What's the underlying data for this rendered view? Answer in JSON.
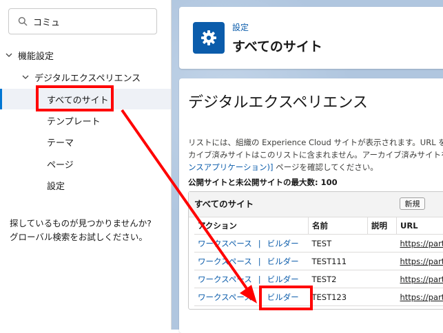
{
  "sidebar": {
    "search": {
      "value": "コミュ",
      "icon": "search-icon"
    },
    "tree": {
      "root": "機能設定",
      "child": "デジタルエクスペリエンス",
      "items": [
        "すべてのサイト",
        "テンプレート",
        "テーマ",
        "ページ",
        "設定"
      ],
      "selected": "すべてのサイト"
    },
    "no_hit_line1": "探しているものが見つかりませんか?",
    "no_hit_line2": "グローバル検索をお試しください。"
  },
  "header": {
    "crumb": "設定",
    "title": "すべてのサイト",
    "icon": "gear-icon"
  },
  "content": {
    "title": "デジタルエクスペリエンス",
    "desc_line1": "リストには、組織の Experience Cloud サイトが表示されます。URL を",
    "desc_line2": "カイブ済みサイトはこのリストに含まれません。アーカイブ済みサイトを",
    "desc_line3_link": "ンスアプリケーション)]",
    "desc_line3_rest": " ページを確認してください。",
    "max_sites": "公開サイトと未公開サイトの最大数: 100"
  },
  "sites": {
    "title": "すべてのサイト",
    "new_button": "新規",
    "columns": [
      "アクション",
      "名前",
      "説明",
      "URL"
    ],
    "action_workspace": "ワークスペース",
    "action_sep": "|",
    "action_builder": "ビルダー",
    "rows": [
      {
        "name": "TEST",
        "url": "https://part"
      },
      {
        "name": "TEST111",
        "url": "https://part"
      },
      {
        "name": "TEST2",
        "url": "https://part"
      },
      {
        "name": "TEST123",
        "url": "https://part"
      }
    ]
  },
  "colors": {
    "accent": "#0b5cab",
    "highlight": "#ff0000",
    "selected_bg": "#eef1f6"
  }
}
